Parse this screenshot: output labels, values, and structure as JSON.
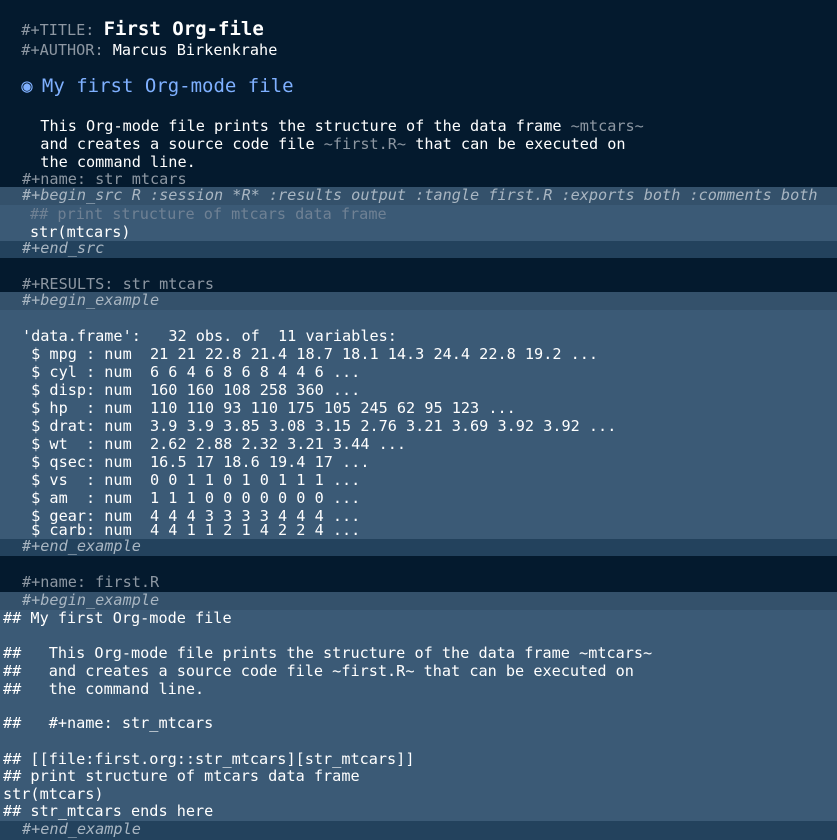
{
  "header": {
    "title_key": "#+TITLE:",
    "title_value": "First Org-file",
    "author_key": "#+AUTHOR:",
    "author_value": "Marcus Birkenkrahe"
  },
  "heading": {
    "bullet": "◉",
    "text": "My first Org-mode file"
  },
  "intro": [
    "This Org-mode file prints the structure of the data frame",
    "and creates a source code file",
    "that can be executed on",
    "the command line."
  ],
  "intro_code": {
    "mtcars": "~mtcars~",
    "first_r": "~first.R~"
  },
  "src_block": {
    "name_line": "#+name: str_mtcars",
    "begin": "#+begin_src R :session *R* :results output :tangle first.R :exports both :comments both",
    "comment": "## print structure of mtcars data frame",
    "code": "str(mtcars)",
    "end": "#+end_src"
  },
  "results": {
    "name_line": "#+RESULTS: str_mtcars",
    "begin": "#+begin_example",
    "lines": [
      "'data.frame':\t32 obs. of  11 variables:",
      " $ mpg : num  21 21 22.8 21.4 18.7 18.1 14.3 24.4 22.8 19.2 ...",
      " $ cyl : num  6 6 4 6 8 6 8 4 4 6 ...",
      " $ disp: num  160 160 108 258 360 ...",
      " $ hp  : num  110 110 93 110 175 105 245 62 95 123 ...",
      " $ drat: num  3.9 3.9 3.85 3.08 3.15 2.76 3.21 3.69 3.92 3.92 ...",
      " $ wt  : num  2.62 2.88 2.32 3.21 3.44 ...",
      " $ qsec: num  16.5 17 18.6 19.4 17 ...",
      " $ vs  : num  0 0 1 1 0 1 0 1 1 1 ...",
      " $ am  : num  1 1 1 0 0 0 0 0 0 0 ...",
      " $ gear: num  4 4 4 3 3 3 3 4 4 4 ...",
      " $ carb: num  4 4 1 1 2 1 4 2 2 4 ..."
    ],
    "end": "#+end_example"
  },
  "tangle": {
    "name_line": "#+name: first.R",
    "begin": "#+begin_example",
    "lines": [
      "## My first Org-mode file",
      "",
      "##   This Org-mode file prints the structure of the data frame ~mtcars~",
      "##   and creates a source code file ~first.R~ that can be executed on",
      "##   the command line.",
      "",
      "##   #+name: str_mtcars",
      "",
      "## [[file:first.org::str_mtcars][str_mtcars]]",
      "## print structure of mtcars data frame",
      "str(mtcars)",
      "## str_mtcars ends here"
    ],
    "end": "#+end_example"
  },
  "colors": {
    "background": "#041a2e",
    "block_background": "#3b5a76",
    "heading": "#7fb0ff",
    "meta_text": "#8d97a2"
  }
}
